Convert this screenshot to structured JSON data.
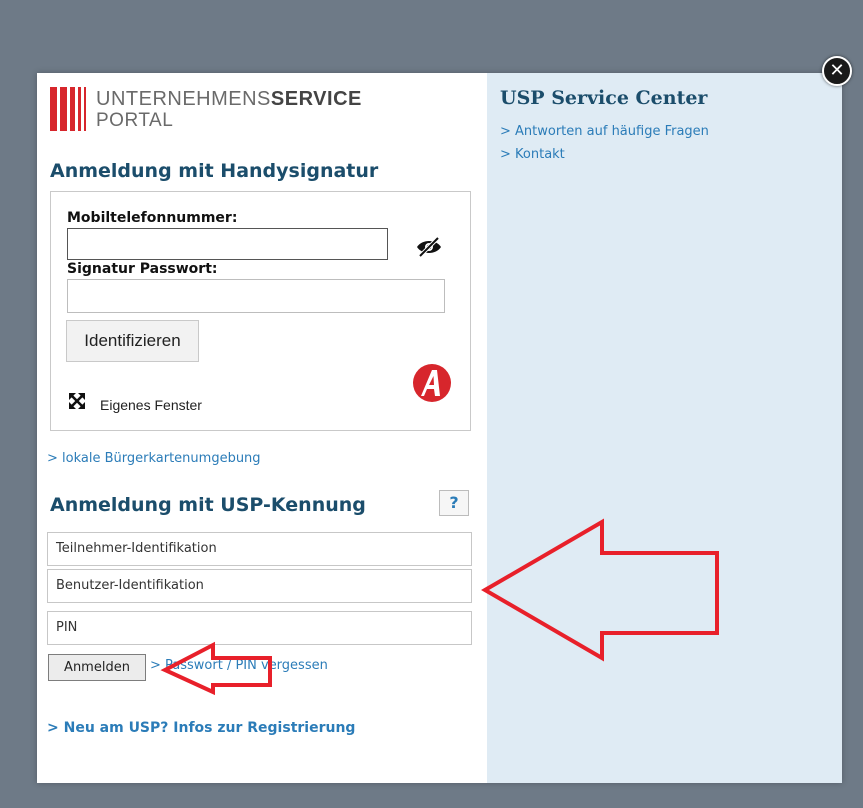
{
  "logo": {
    "line1_regular": "UNTERNEHMENS",
    "line1_bold": "SERVICE",
    "line2": "PORTAL",
    "color": "#d7262c"
  },
  "handy": {
    "heading": "Anmeldung mit Handysignatur",
    "phone_label": "Mobiltelefonnummer:",
    "phone_value": "",
    "password_label": "Signatur Passwort:",
    "password_value": "",
    "identify_label": "Identifizieren",
    "own_window_label": "Eigenes Fenster"
  },
  "local_link": "> lokale Bürgerkartenumgebung",
  "usp": {
    "heading": "Anmeldung mit USP-Kennung",
    "help_label": "?",
    "participant_placeholder": "Teilnehmer-Identifikation",
    "user_placeholder": "Benutzer-Identifikation",
    "pin_placeholder": "PIN",
    "login_label": "Anmelden",
    "forgot_link": "> Passwort / PIN vergessen"
  },
  "register_link": ">  Neu am USP? Infos zur Registrierung",
  "service_center": {
    "title": "USP Service Center",
    "links": [
      "> Antworten auf häufige Fragen",
      "> Kontakt"
    ]
  },
  "colors": {
    "heading": "#1b4d6b",
    "link": "#2b7cb8",
    "panel": "#dfebf4",
    "backdrop": "#6e7a87",
    "annotation": "#e8202a"
  },
  "icons": [
    "close-icon",
    "eye-slash-icon",
    "a-trust-logo",
    "expand-icon"
  ]
}
